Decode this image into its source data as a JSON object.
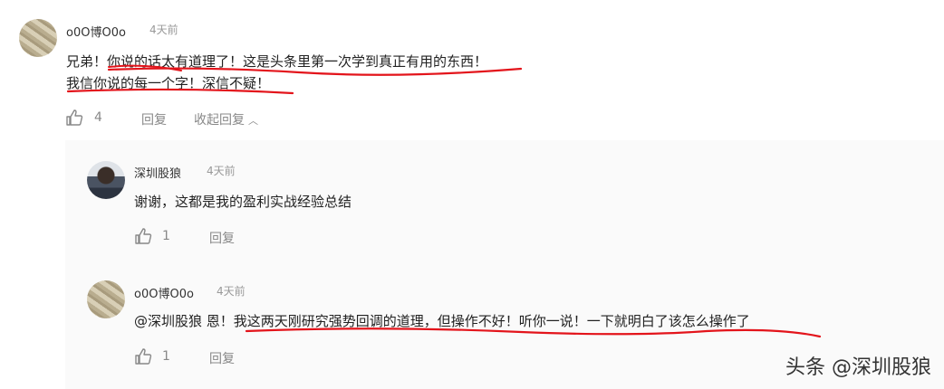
{
  "comments": [
    {
      "username": "o0O博O0o",
      "time": "4天前",
      "line1": "兄弟！你说的话太有道理了！这是头条里第一次学到真正有用的东西！",
      "line2": "我信你说的每一个字！深信不疑！",
      "likes": "4",
      "reply_label": "回复",
      "collapse_label": "收起回复"
    },
    {
      "username": "深圳股狼",
      "time": "4天前",
      "text": "谢谢，这都是我的盈利实战经验总结",
      "likes": "1",
      "reply_label": "回复"
    },
    {
      "username": "o0O博O0o",
      "time": "4天前",
      "mention": "@深圳股狼",
      "text": " 恩！我这两天刚研究强势回调的道理，但操作不好！听你一说！一下就明白了该怎么操作了",
      "likes": "1",
      "reply_label": "回复"
    }
  ],
  "watermark": "头条 @深圳股狼",
  "colors": {
    "underline": "#e3141b",
    "muted": "#888888",
    "text": "#222222"
  },
  "icons": {
    "like": "thumbs-up-icon",
    "collapse": "chevron-up-icon"
  }
}
